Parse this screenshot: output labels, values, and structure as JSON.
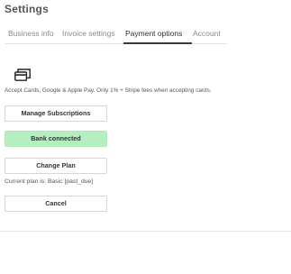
{
  "header": {
    "title": "Settings"
  },
  "tabs": [
    {
      "label": "Business info",
      "active": false
    },
    {
      "label": "Invoice settings",
      "active": false
    },
    {
      "label": "Payment options",
      "active": true
    },
    {
      "label": "Account",
      "active": false
    }
  ],
  "payment": {
    "icon": "credit-cards-icon",
    "description": "Accept Cards, Google & Apple Pay. Only 1% + Stripe fees when accepting cards.",
    "manage_subscriptions_label": "Manage Subscriptions",
    "bank_connected_label": "Bank connected",
    "change_plan_label": "Change Plan",
    "current_plan_text": "Current plan is: Basic [past_due]",
    "cancel_label": "Cancel"
  },
  "colors": {
    "bank_connected_bg": "#b4f0bf",
    "active_tab_underline": "#3a3a3a"
  }
}
